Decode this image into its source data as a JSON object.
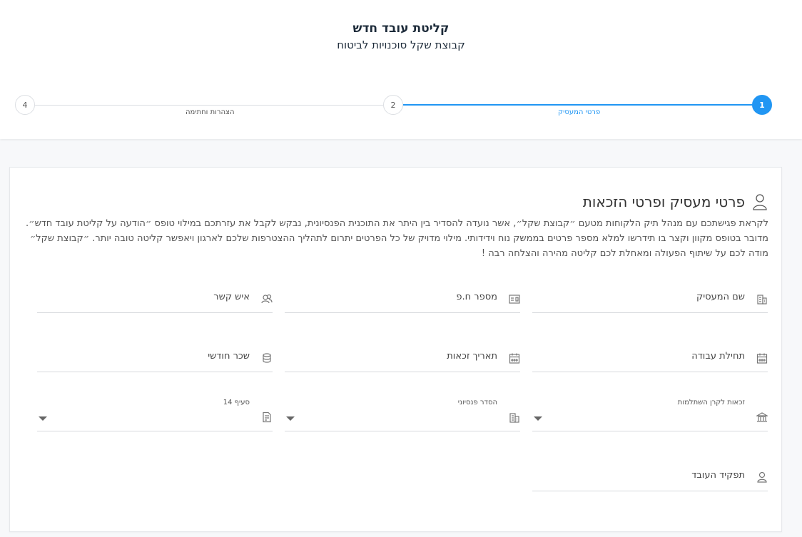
{
  "header": {
    "title": "קליטת עובד חדש",
    "subtitle": "קבוצת שקל סוכנויות לביטוח"
  },
  "stepper": {
    "steps": [
      {
        "number": "1",
        "label": "פרטי המעסיק",
        "active": true
      },
      {
        "number": "2",
        "label": "",
        "active": false
      },
      {
        "number": "4",
        "label": "הצהרות וחתימה",
        "active": false
      }
    ],
    "mid_label": "הצהרות וחתימה"
  },
  "section": {
    "title": "פרטי מעסיק ופרטי הזכאות",
    "intro": "לקראת פגישתכם עם מנהל תיק הלקוחות מטעם ״קבוצת שקל״, אשר נועדה להסדיר בין היתר את התוכנית הפנסיונית, נבקש לקבל את עזרתכם במילוי טופס ״הודעה על קליטת עובד חדש״. מדובר בטופס מקוון וקצר בו תידרשו למלא מספר פרטים בממשק נוח וידידותי. מילוי מדויק של כל הפרטים יתרום לתהליך ההצטרפות שלכם לארגון ויאפשר קליטה טובה יותר. ״קבוצת שקל״ מודה לכם על שיתוף הפעולה ומאחלת לכם קליטה מהירה והצלחה רבה !"
  },
  "fields": {
    "employer_name": {
      "label": "שם המעסיק",
      "icon": "building-icon"
    },
    "company_number": {
      "label": "מספר ח.פ",
      "icon": "id-card-icon"
    },
    "contact_person": {
      "label": "איש קשר",
      "icon": "users-icon"
    },
    "start_date": {
      "label": "תחילת עבודה",
      "icon": "calendar-icon"
    },
    "eligibility_date": {
      "label": "תאריך זכאות",
      "icon": "calendar-icon"
    },
    "monthly_salary": {
      "label": "שכר חודשי",
      "icon": "coins-icon"
    },
    "study_fund": {
      "label": "זכאות לקרן השתלמות",
      "icon": "bank-icon"
    },
    "pension": {
      "label": "הסדר פנסיוני",
      "icon": "building-icon"
    },
    "section14": {
      "label": "סעיף 14",
      "icon": "document-icon"
    },
    "employee_role": {
      "label": "תפקיד העובד",
      "icon": "user-icon"
    }
  },
  "colors": {
    "accent": "#2196f3",
    "text": "#1d2b3a"
  }
}
